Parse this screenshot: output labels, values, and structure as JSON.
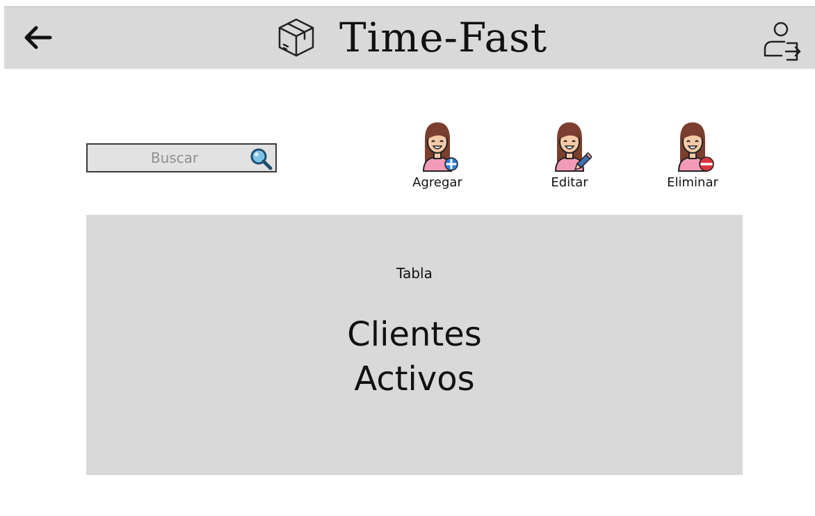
{
  "header": {
    "title": "Time-Fast",
    "back_icon": "arrow-left-icon",
    "brand_icon": "package-box-icon",
    "logout_icon": "user-logout-icon"
  },
  "search": {
    "placeholder": "Buscar",
    "value": "",
    "icon": "magnifier-icon"
  },
  "actions": [
    {
      "label": "Agregar",
      "icon": "add-client-icon"
    },
    {
      "label": "Editar",
      "icon": "edit-client-icon"
    },
    {
      "label": "Eliminar",
      "icon": "remove-client-icon"
    }
  ],
  "table": {
    "caption": "Tabla",
    "title_line1": "Clientes",
    "title_line2": "Activos"
  },
  "colors": {
    "header_bg": "#d9d9d9",
    "panel_bg": "#d9d9d9",
    "add_badge": "#2f7fd6",
    "remove_badge": "#d9363e",
    "hair": "#7a3f2e",
    "skin": "#f6c9a8",
    "shirt": "#f29bb8"
  }
}
